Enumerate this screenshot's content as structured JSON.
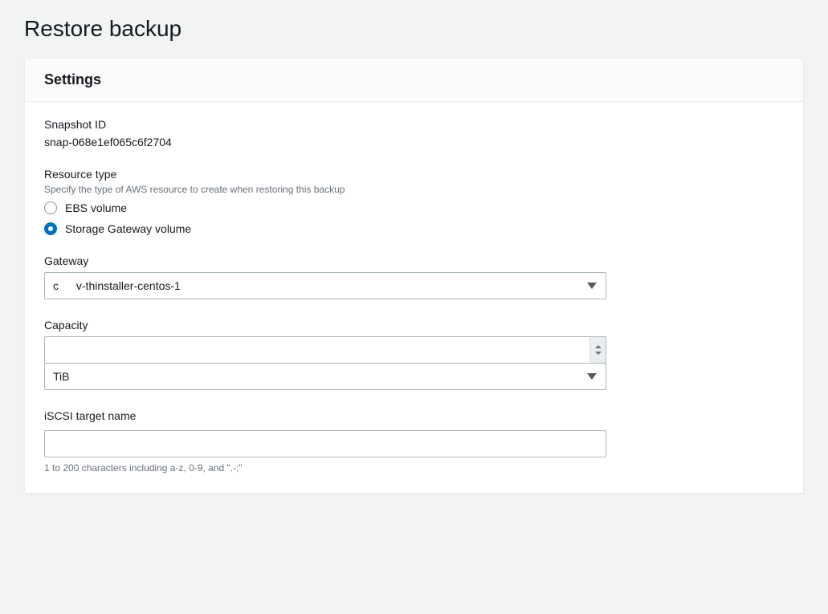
{
  "page": {
    "title": "Restore backup"
  },
  "panel": {
    "header": "Settings"
  },
  "snapshot": {
    "label": "Snapshot ID",
    "value": "snap-068e1ef065c6f2704"
  },
  "resourceType": {
    "label": "Resource type",
    "description": "Specify the type of AWS resource to create when restoring this backup",
    "options": {
      "ebs": "EBS volume",
      "sgw": "Storage Gateway volume"
    },
    "selected": "sgw"
  },
  "gateway": {
    "label": "Gateway",
    "valuePrefix": "c",
    "valueSuffix": "v-thinstaller-centos-1"
  },
  "capacity": {
    "label": "Capacity",
    "value": "",
    "unit": "TiB"
  },
  "iscsi": {
    "label": "iSCSI target name",
    "value": "",
    "hint": "1 to 200 characters including a-z, 0-9, and \".-;\""
  }
}
